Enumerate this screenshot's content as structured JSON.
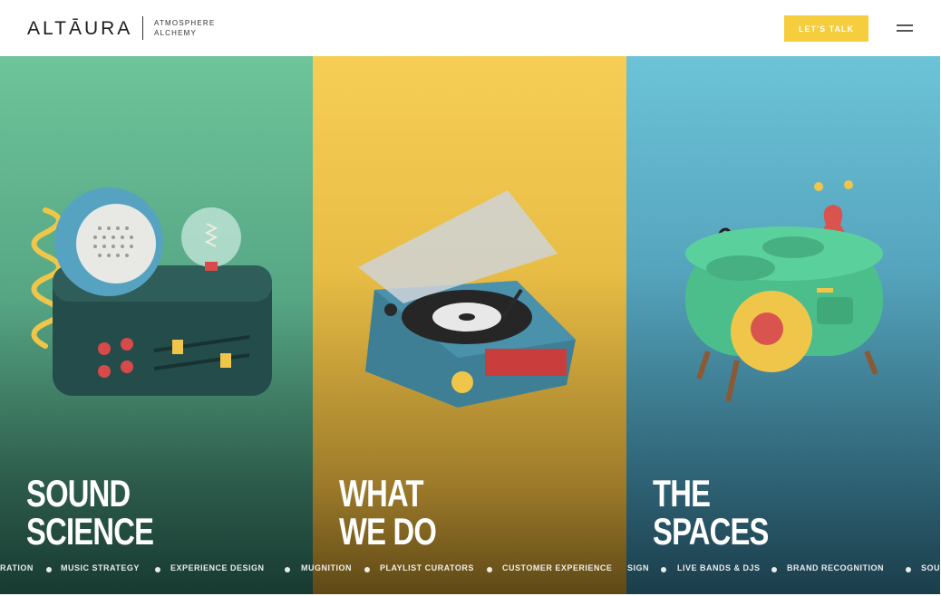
{
  "header": {
    "logo_text": "ALTĀURA",
    "tagline_line1": "ATMOSPHERE",
    "tagline_line2": "ALCHEMY",
    "cta_label": "LET'S TALK",
    "menu_icon": "hamburger-menu-icon"
  },
  "panels": [
    {
      "title_line1": "SOUND",
      "title_line2": "SCIENCE",
      "color": "#6ec49a",
      "illustration": "radio-icon"
    },
    {
      "title_line1": "WHAT",
      "title_line2": "WE DO",
      "color": "#f6cd55",
      "illustration": "record-player-icon"
    },
    {
      "title_line1": "THE",
      "title_line2": "SPACES",
      "color": "#6cc3d8",
      "illustration": "sideboard-icon"
    }
  ],
  "ticker": {
    "items": [
      "RATION",
      "MUSIC STRATEGY",
      "EXPERIENCE DESIGN",
      "MUGNITION",
      "PLAYLIST CURATORS",
      "CUSTOMER EXPERIENCE",
      "SIGN",
      "LIVE BANDS & DJS",
      "BRAND RECOGNITION",
      "SOU"
    ]
  },
  "colors": {
    "accent": "#f6cd3c",
    "green": "#6ec49a",
    "yellow": "#f6cd55",
    "blue": "#6cc3d8"
  }
}
